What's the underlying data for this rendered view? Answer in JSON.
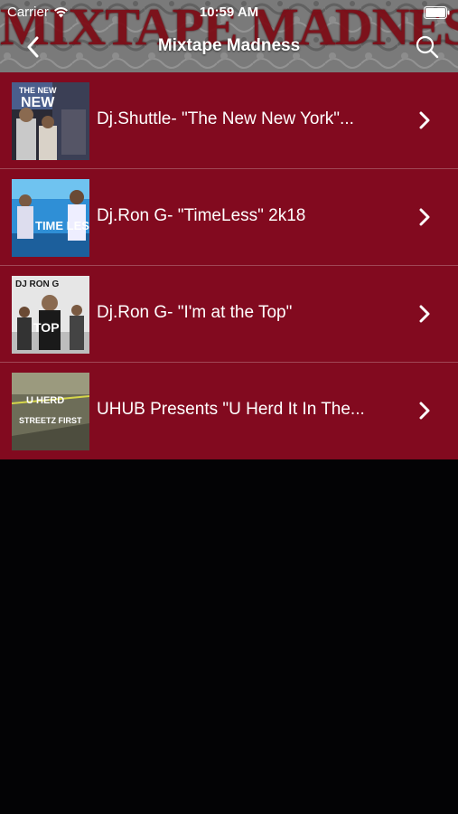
{
  "status_bar": {
    "carrier": "Carrier",
    "time": "10:59 AM"
  },
  "header": {
    "banner_text": "MIXTAPE MADNESS",
    "title": "Mixtape Madness",
    "back_icon": "chevron-left-icon",
    "search_icon": "search-icon"
  },
  "colors": {
    "list_background": "#820a1f",
    "separator": "#a04756",
    "text": "#ffffff",
    "empty_background": "#030305"
  },
  "mixtapes": [
    {
      "title": "Dj.Shuttle- \"The New New York\"...",
      "cover_text_top": "THE NEW",
      "cover_text_main": "NEW"
    },
    {
      "title": "Dj.Ron G- \"TimeLess\" 2k18",
      "cover_text_main": "TIME LESS"
    },
    {
      "title": "Dj.Ron G- \"I'm at the Top\"",
      "cover_text_top": "DJ RON G",
      "cover_text_main": "TOP"
    },
    {
      "title": "UHUB Presents \"U Herd It In The...",
      "cover_text_top": "U HERD",
      "cover_text_main": "STREETZ FIRST"
    }
  ]
}
